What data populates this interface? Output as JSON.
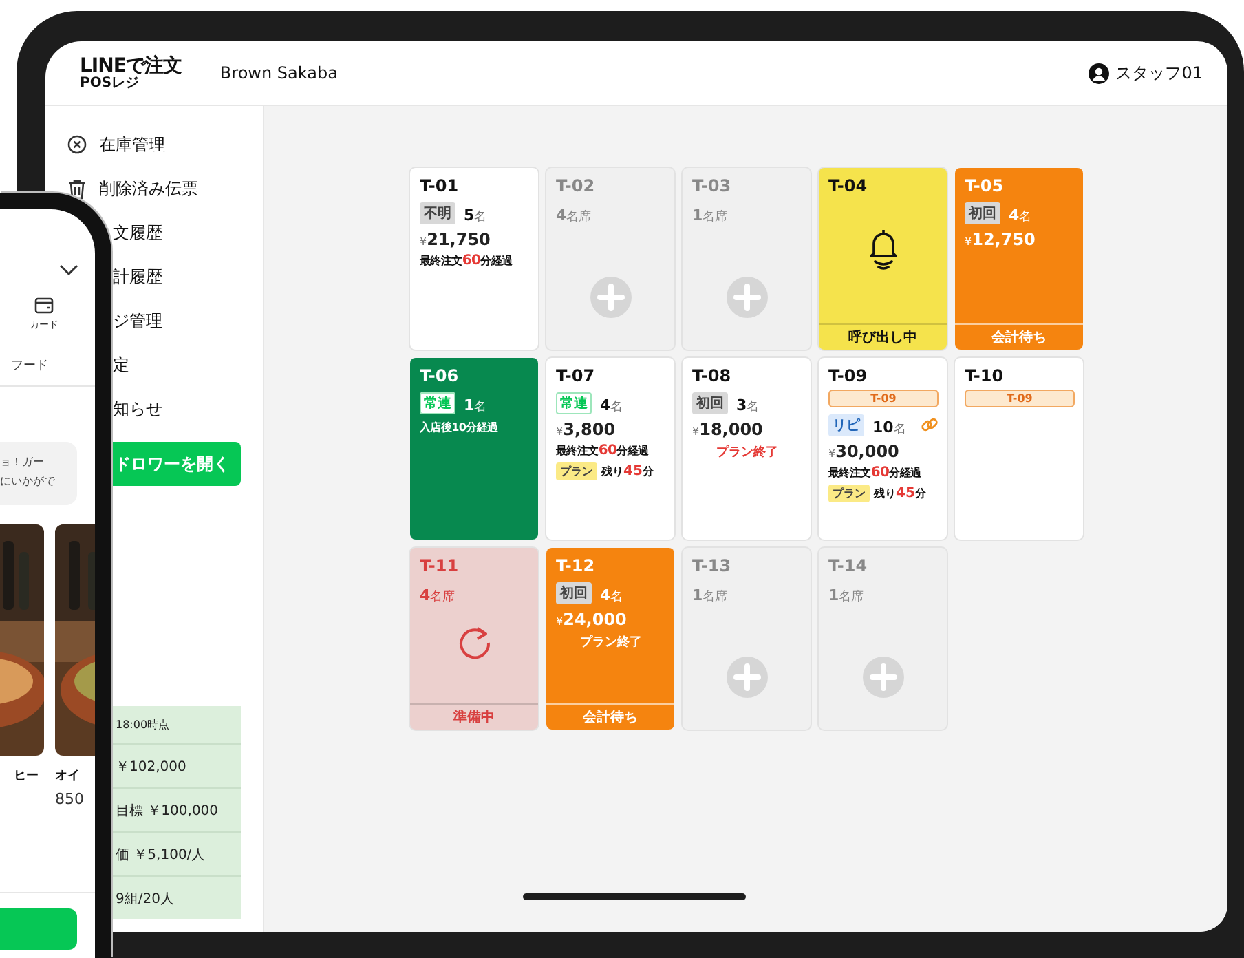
{
  "header": {
    "logo_title": "LINEで注文",
    "logo_subtitle": "POSレジ",
    "store": "Brown Sakaba",
    "user": "スタッフ01"
  },
  "sidebar": {
    "items": [
      {
        "label": "在庫管理"
      },
      {
        "label": "削除済み伝票"
      },
      {
        "label": "文履歴"
      },
      {
        "label": "計履歴"
      },
      {
        "label": "ジ管理"
      },
      {
        "label": "定"
      },
      {
        "label": "知らせ"
      }
    ],
    "button": "ドロワーを開く",
    "stats": {
      "as_of": "18:00時点",
      "rows": [
        "￥102,000",
        "目標 ￥100,000",
        "価 ￥5,100/人",
        "9組/20人"
      ]
    }
  },
  "tables": [
    {
      "id": "T-01",
      "kind": "occupied",
      "tag": {
        "label": "不明",
        "kind": "grey"
      },
      "count": "5",
      "unit": "名",
      "currency": "¥",
      "amount": "21,750",
      "note": {
        "before": "最終注文",
        "value": "60",
        "after": "分経過"
      }
    },
    {
      "id": "T-02",
      "kind": "empty",
      "count": "4",
      "unit": "名席"
    },
    {
      "id": "T-03",
      "kind": "empty",
      "count": "1",
      "unit": "名席"
    },
    {
      "id": "T-04",
      "kind": "calling",
      "footer": "呼び出し中"
    },
    {
      "id": "T-05",
      "kind": "checkout",
      "tag": {
        "label": "初回",
        "kind": "grey"
      },
      "count": "4",
      "unit": "名",
      "currency": "¥",
      "amount": "12,750",
      "footer": "会計待ち"
    },
    {
      "id": "T-06",
      "kind": "fresh",
      "tag": {
        "label": "常連",
        "kind": "regular"
      },
      "count": "1",
      "unit": "名",
      "note": {
        "before": "入店後10分経過"
      }
    },
    {
      "id": "T-07",
      "kind": "occupied",
      "tag": {
        "label": "常連",
        "kind": "regular"
      },
      "count": "4",
      "unit": "名",
      "currency": "¥",
      "amount": "3,800",
      "note": {
        "before": "最終注文",
        "value": "60",
        "after": "分経過"
      },
      "plan": {
        "label": "プラン",
        "remaining": {
          "before": "残り",
          "value": "45",
          "after": "分"
        }
      }
    },
    {
      "id": "T-08",
      "kind": "occupied",
      "tag": {
        "label": "初回",
        "kind": "grey"
      },
      "count": "3",
      "unit": "名",
      "currency": "¥",
      "amount": "18,000",
      "plan_end": "プラン終了"
    },
    {
      "id": "T-09",
      "kind": "occupied",
      "link": "T-09",
      "tag": {
        "label": "リピ",
        "kind": "repeat"
      },
      "count": "10",
      "unit": "名",
      "linked": true,
      "currency": "¥",
      "amount": "30,000",
      "note": {
        "before": "最終注文",
        "value": "60",
        "after": "分経過"
      },
      "plan": {
        "label": "プラン",
        "remaining": {
          "before": "残り",
          "value": "45",
          "after": "分"
        }
      }
    },
    {
      "id": "T-10",
      "kind": "occupied",
      "link": "T-09"
    },
    {
      "id": "T-11",
      "kind": "preparing",
      "count": "4",
      "unit": "名席",
      "footer": "準備中"
    },
    {
      "id": "T-12",
      "kind": "checkout",
      "tag": {
        "label": "初回",
        "kind": "grey"
      },
      "count": "4",
      "unit": "名",
      "currency": "¥",
      "amount": "24,000",
      "plan_end": "プラン終了",
      "footer": "会計待ち"
    },
    {
      "id": "T-13",
      "kind": "empty",
      "count": "1",
      "unit": "名席"
    },
    {
      "id": "T-14",
      "kind": "empty",
      "count": "1",
      "unit": "名席"
    }
  ],
  "phone": {
    "tab_label": "カード",
    "category": "フード",
    "message_lines": [
      "ョ！ガー",
      "にいかがで"
    ],
    "products": [
      {
        "name": "ヒー",
        "kind": "picture"
      },
      {
        "name": "オイ",
        "price": "850",
        "kind": "picture"
      }
    ]
  }
}
